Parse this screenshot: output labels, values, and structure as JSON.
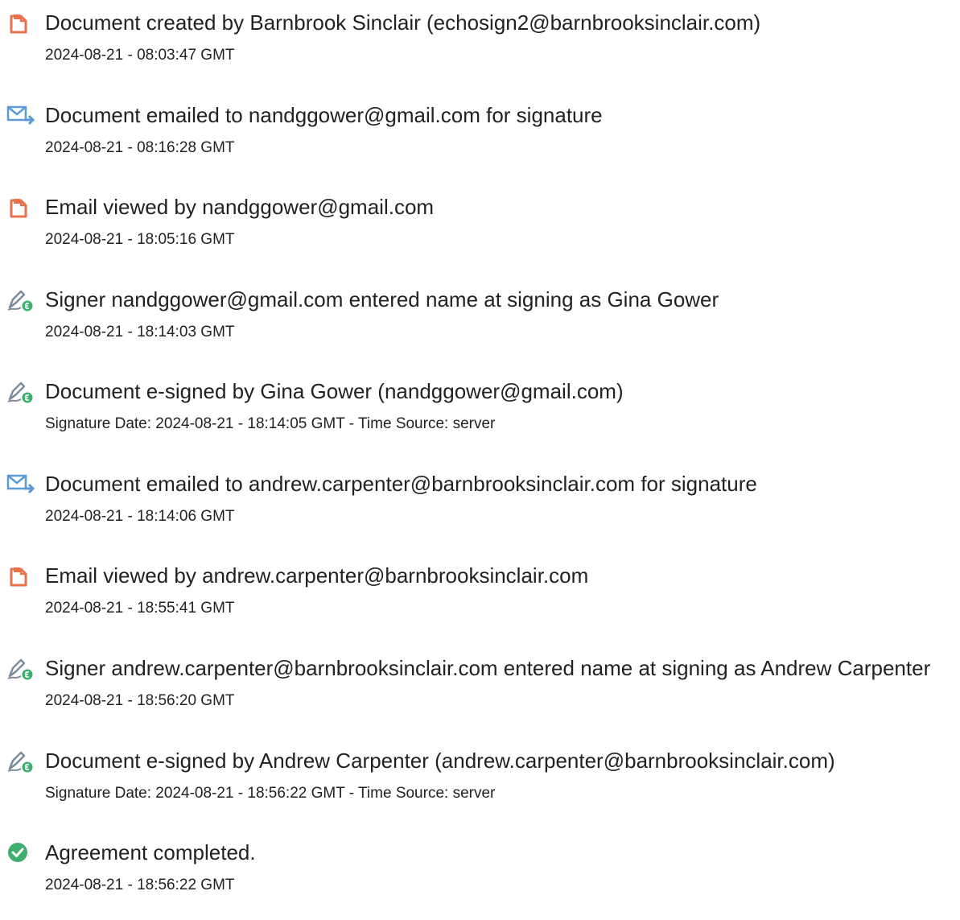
{
  "events": [
    {
      "icon": "document-created-icon",
      "title": "Document created by Barnbrook Sinclair (echosign2@barnbrooksinclair.com)",
      "detail": "2024-08-21 - 08:03:47 GMT"
    },
    {
      "icon": "email-sent-icon",
      "title": "Document emailed to nandggower@gmail.com for signature",
      "detail": "2024-08-21 - 08:16:28 GMT"
    },
    {
      "icon": "document-viewed-icon",
      "title": "Email viewed by nandggower@gmail.com",
      "detail": "2024-08-21 - 18:05:16 GMT"
    },
    {
      "icon": "e-sign-pen-icon",
      "title": "Signer nandggower@gmail.com entered name at signing as Gina Gower",
      "detail": "2024-08-21 - 18:14:03 GMT"
    },
    {
      "icon": "e-sign-pen-icon",
      "title": "Document e-signed by Gina Gower (nandggower@gmail.com)",
      "detail": "Signature Date: 2024-08-21 - 18:14:05 GMT - Time Source: server"
    },
    {
      "icon": "email-sent-icon",
      "title": "Document emailed to andrew.carpenter@barnbrooksinclair.com for signature",
      "detail": "2024-08-21 - 18:14:06 GMT"
    },
    {
      "icon": "document-viewed-icon",
      "title": "Email viewed by andrew.carpenter@barnbrooksinclair.com",
      "detail": "2024-08-21 - 18:55:41 GMT"
    },
    {
      "icon": "e-sign-pen-icon",
      "title": "Signer andrew.carpenter@barnbrooksinclair.com entered name at signing as Andrew Carpenter",
      "detail": "2024-08-21 - 18:56:20 GMT"
    },
    {
      "icon": "e-sign-pen-icon",
      "title": "Document e-signed by Andrew Carpenter (andrew.carpenter@barnbrooksinclair.com)",
      "detail": "Signature Date: 2024-08-21 - 18:56:22 GMT - Time Source: server"
    },
    {
      "icon": "check-circle-icon",
      "title": "Agreement completed.",
      "detail": "2024-08-21 - 18:56:22 GMT"
    }
  ],
  "colors": {
    "document_icon": "#e8714e",
    "email_icon": "#5b9bd5",
    "pen_icon": "#7c8c9c",
    "e_badge": "#3fae6f",
    "check": "#3fae6f",
    "text": "#222222"
  }
}
